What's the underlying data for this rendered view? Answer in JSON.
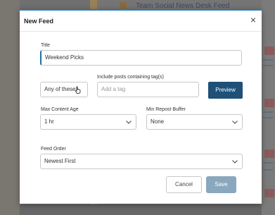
{
  "background": {
    "header_text": "Team Social News Desk Feed"
  },
  "modal": {
    "title": "New Feed",
    "close_label": "×"
  },
  "form": {
    "title_label": "Title",
    "title_value": "Weekend Picks",
    "match_select_value": "Any of these",
    "tags_label": "Include posts containing tag(s)",
    "tags_placeholder": "Add a tag",
    "preview_label": "Preview",
    "max_age_label": "Max Content Age",
    "max_age_value": "1 hr",
    "repost_label": "Min Repost Buffer",
    "repost_value": "None",
    "order_label": "Feed Order",
    "order_value": "Newest First"
  },
  "footer": {
    "cancel_label": "Cancel",
    "save_label": "Save"
  },
  "colors": {
    "accent": "#1e5078",
    "save_disabled": "#8aa8bd"
  }
}
